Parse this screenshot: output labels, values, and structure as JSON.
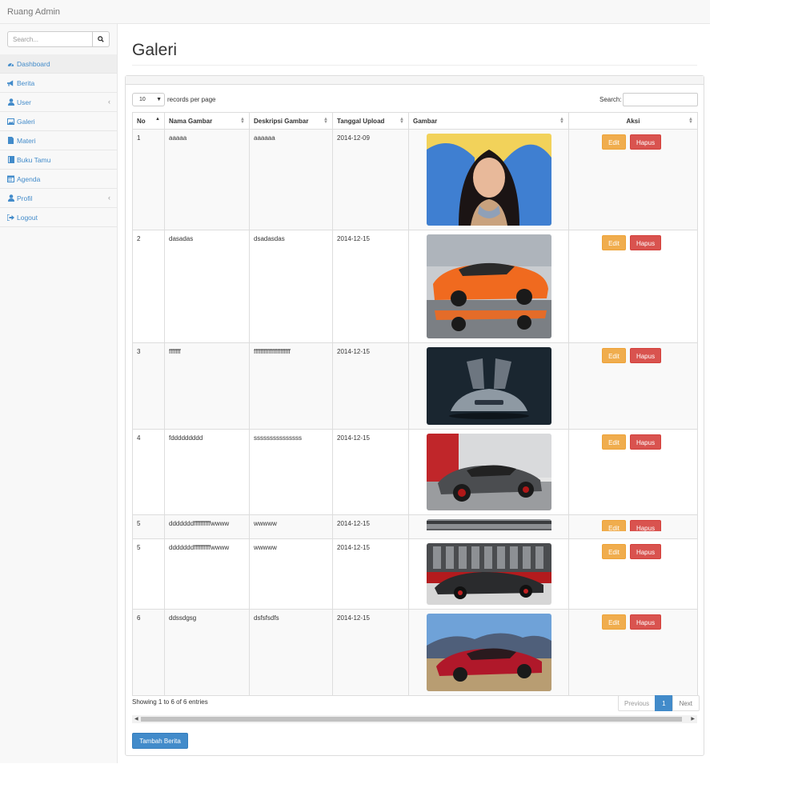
{
  "app": {
    "brand": "Ruang Admin"
  },
  "sidebar": {
    "search_placeholder": "Search...",
    "items": [
      {
        "label": "Dashboard",
        "icon": "dashboard-icon",
        "active": true
      },
      {
        "label": "Berita",
        "icon": "bullhorn-icon"
      },
      {
        "label": "User",
        "icon": "user-icon",
        "has_children": true
      },
      {
        "label": "Galeri",
        "icon": "picture-icon"
      },
      {
        "label": "Materi",
        "icon": "file-icon"
      },
      {
        "label": "Buku Tamu",
        "icon": "book-icon"
      },
      {
        "label": "Agenda",
        "icon": "calendar-icon"
      },
      {
        "label": "Profil",
        "icon": "user-icon",
        "has_children": true
      },
      {
        "label": "Logout",
        "icon": "sign-out-icon"
      }
    ]
  },
  "page": {
    "title": "Galeri"
  },
  "table_controls": {
    "length_value": "10",
    "length_suffix": "records per page",
    "search_label": "Search:"
  },
  "table": {
    "columns": [
      "No",
      "Nama Gambar",
      "Deskripsi Gambar",
      "Tanggal Upload",
      "Gambar",
      "Aksi"
    ],
    "edit_label": "Edit",
    "delete_label": "Hapus",
    "rows": [
      {
        "no": "1",
        "nama": "aaaaa",
        "deskripsi": "aaaaaa",
        "tanggal": "2014-12-09",
        "image": "portrait-woman"
      },
      {
        "no": "2",
        "nama": "dasadas",
        "deskripsi": "dsadasdas",
        "tanggal": "2014-12-15",
        "image": "orange-sports-car"
      },
      {
        "no": "3",
        "nama": "fffffff",
        "deskripsi": "ffffffffffffffffffffff",
        "tanggal": "2014-12-15",
        "image": "silver-concept-car"
      },
      {
        "no": "4",
        "nama": "fddddddddd",
        "deskripsi": "sssssssssssssss",
        "tanggal": "2014-12-15",
        "image": "grey-sports-car"
      },
      {
        "no": "5",
        "nama": "dddddddffffffffffwwww",
        "deskripsi": "wwwww",
        "tanggal": "2014-12-15",
        "image": "black-sports-car"
      },
      {
        "no": "5",
        "nama": "dddddddffffffffffwwww",
        "deskripsi": "wwwww",
        "tanggal": "2014-12-15",
        "image": "black-sports-car"
      },
      {
        "no": "6",
        "nama": "ddssdgsg",
        "deskripsi": "dsfsfsdfs",
        "tanggal": "2014-12-15",
        "image": "red-sedan"
      }
    ]
  },
  "footer": {
    "info": "Showing 1 to 6 of 6 entries",
    "prev_label": "Previous",
    "current_page": "1",
    "next_label": "Next",
    "add_button": "Tambah Berita"
  }
}
